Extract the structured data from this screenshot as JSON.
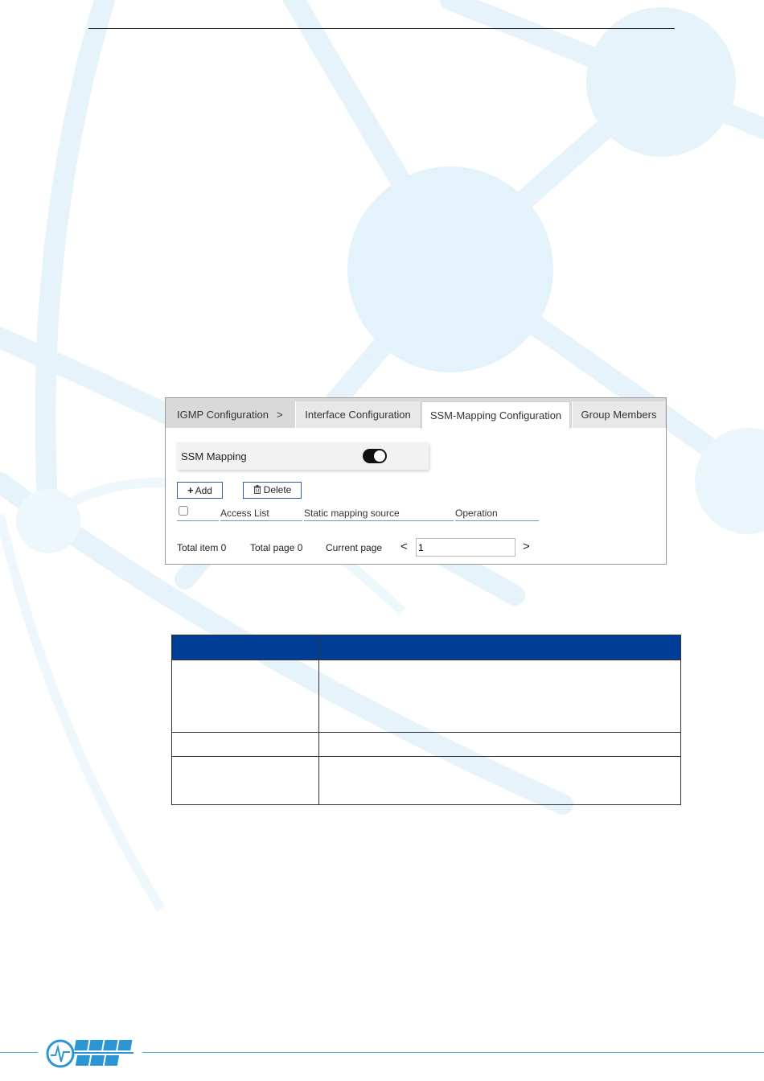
{
  "colors": {
    "accent": "#2e5fa8",
    "table_header": "#003d96",
    "background_shapes": "#e6f3fb",
    "bottom_rule": "#4aa8dc"
  },
  "ui": {
    "tabs": {
      "igmp": "IGMP Configuration",
      "separator": ">",
      "interface": "Interface Configuration",
      "ssm": "SSM-Mapping Configuration",
      "group": "Group Members"
    },
    "ssm_mapping": {
      "label": "SSM Mapping",
      "enabled": true
    },
    "buttons": {
      "add": "Add",
      "delete": "Delete"
    },
    "grid": {
      "columns": [
        "Access List",
        "Static mapping source",
        "Operation"
      ]
    },
    "pager": {
      "total_item": "Total item 0",
      "total_page": "Total page 0",
      "current_page": "Current page",
      "prev": "<",
      "next": ">",
      "page_value": "1"
    }
  },
  "logo": {
    "letters_top": [
      "I",
      "n",
      "d",
      "u"
    ],
    "letters_bottom": [
      "S",
      "o",
      "l"
    ]
  }
}
